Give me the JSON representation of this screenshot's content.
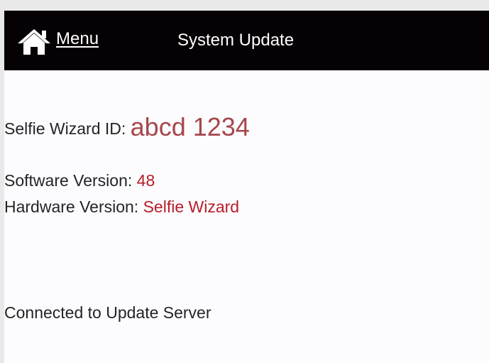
{
  "header": {
    "home_icon": "home-icon",
    "menu_label": "Menu",
    "title": "System Update"
  },
  "device": {
    "id_label": "Selfie Wizard ID:",
    "id_value": "abcd 1234",
    "software_label": "Software Version:",
    "software_value": "48",
    "hardware_label": "Hardware Version:",
    "hardware_value": "Selfie Wizard"
  },
  "status": {
    "text": "Connected to Update Server"
  },
  "colors": {
    "header_bg": "#060105",
    "header_text": "#ffffff",
    "value_red": "#b71d28",
    "id_red": "#a5474d",
    "background": "#fcfbfd"
  }
}
